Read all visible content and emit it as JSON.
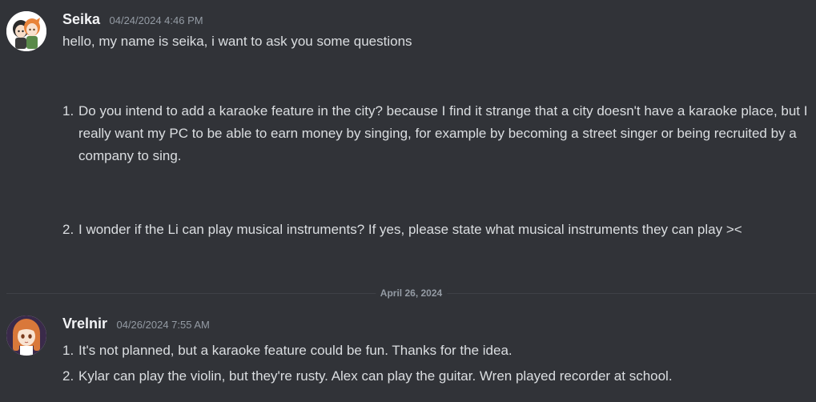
{
  "messages": [
    {
      "username": "Seika",
      "timestamp": "04/24/2024 4:46 PM",
      "intro": "hello, my name is seika, i want to ask you some questions",
      "items": [
        {
          "number": "1.",
          "text": "Do you intend to add a karaoke feature in the city?  because I find it strange that a city doesn't have a karaoke place, but I really want my PC to be able to earn money by singing, for example by becoming a street singer or being recruited by a company to sing."
        },
        {
          "number": "2.",
          "text": "I wonder if the Li can play musical instruments?  If yes, please state what musical instruments they can play ><"
        }
      ],
      "avatar_icon": "anime-couple-avatar-icon"
    },
    {
      "username": "Vrelnir",
      "timestamp": "04/26/2024 7:55 AM",
      "items": [
        {
          "number": "1.",
          "text": "It's not planned, but a karaoke feature could be fun. Thanks for the idea."
        },
        {
          "number": "2.",
          "text": "Kylar can play the violin, but they're rusty. Alex can play the guitar. Wren played recorder at school."
        }
      ],
      "avatar_icon": "anime-girl-avatar-icon"
    }
  ],
  "date_divider": "April 26, 2024",
  "colors": {
    "background": "#313338",
    "text": "#dbdee1",
    "username": "#f2f3f5",
    "muted": "#949ba4",
    "divider": "#3f4147"
  }
}
